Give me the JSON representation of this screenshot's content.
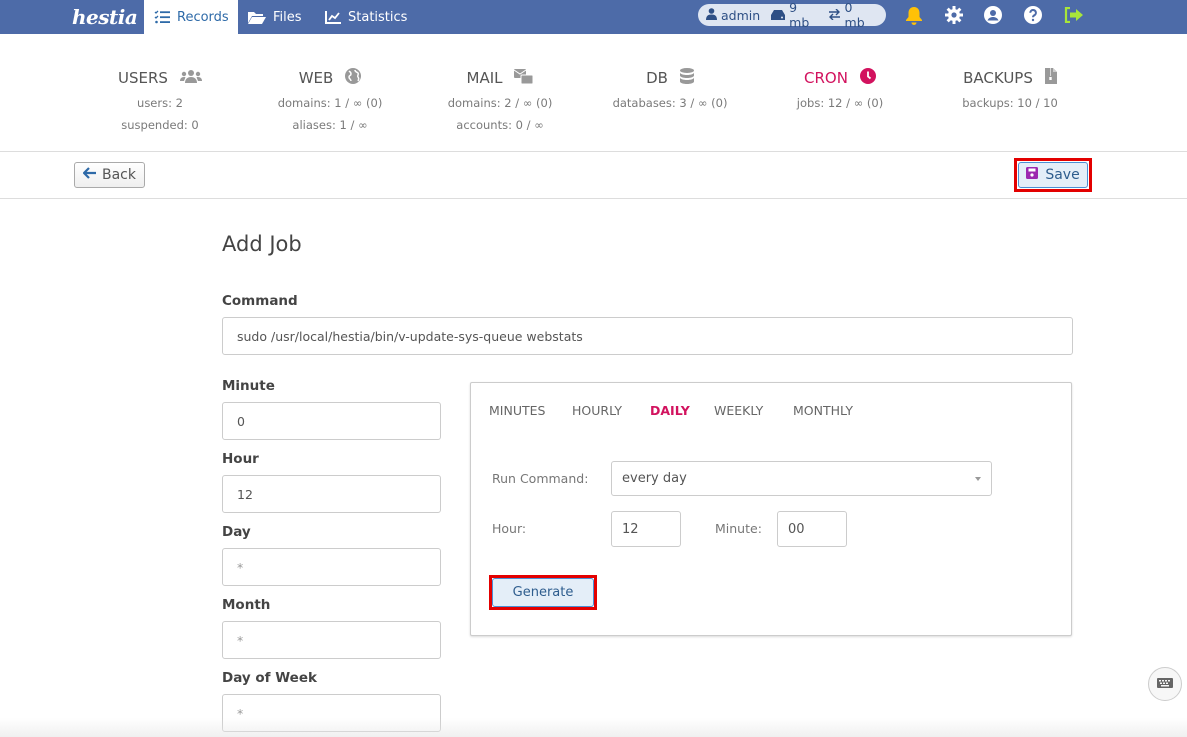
{
  "app": {
    "logo_text": "hestia"
  },
  "nav": {
    "tabs": [
      {
        "label": "Records",
        "icon": "records-list-icon",
        "active": true
      },
      {
        "label": "Files",
        "icon": "folder-open-icon",
        "active": false
      },
      {
        "label": "Statistics",
        "icon": "chart-line-icon",
        "active": false
      }
    ]
  },
  "user_status": {
    "username": "admin",
    "disk": "9 mb",
    "bandwidth": "0 mb"
  },
  "top_icons": [
    "bell-icon",
    "gear-icon",
    "user-circle-icon",
    "help-icon",
    "logout-icon"
  ],
  "colors": {
    "topbar": "#4d6ba8",
    "accent": "#d2125e",
    "bell": "#ffc107",
    "logout": "#a8e63a",
    "highlight": "#e30000"
  },
  "stats": [
    {
      "title": "USERS",
      "icon": "users-icon",
      "lines": [
        "users: 2",
        "suspended: 0"
      ],
      "active": false
    },
    {
      "title": "WEB",
      "icon": "globe-icon",
      "lines": [
        "domains: 1 / ∞ (0)",
        "aliases: 1 / ∞"
      ],
      "active": false
    },
    {
      "title": "MAIL",
      "icon": "mail-icon",
      "lines": [
        "domains: 2 / ∞ (0)",
        "accounts: 0 / ∞"
      ],
      "active": false
    },
    {
      "title": "DB",
      "icon": "database-icon",
      "lines": [
        "databases: 3 / ∞ (0)"
      ],
      "active": false
    },
    {
      "title": "CRON",
      "icon": "clock-icon",
      "lines": [
        "jobs: 12 / ∞ (0)"
      ],
      "active": true
    },
    {
      "title": "BACKUPS",
      "icon": "file-archive-icon",
      "lines": [
        "backups: 10 / 10"
      ],
      "active": false
    }
  ],
  "toolbar": {
    "back_label": "Back",
    "save_label": "Save"
  },
  "form": {
    "title": "Add Job",
    "command": {
      "label": "Command",
      "value": "sudo /usr/local/hestia/bin/v-update-sys-queue webstats"
    },
    "minute": {
      "label": "Minute",
      "value": "0"
    },
    "hour": {
      "label": "Hour",
      "value": "12"
    },
    "day": {
      "label": "Day",
      "value": "*"
    },
    "month": {
      "label": "Month",
      "value": "*"
    },
    "day_of_week": {
      "label": "Day of Week",
      "value": "*"
    }
  },
  "generator": {
    "tabs": [
      {
        "label": "MINUTES",
        "active": false
      },
      {
        "label": "HOURLY",
        "active": false
      },
      {
        "label": "DAILY",
        "active": true
      },
      {
        "label": "WEEKLY",
        "active": false
      },
      {
        "label": "MONTHLY",
        "active": false
      }
    ],
    "run_command_label": "Run Command:",
    "run_command_value": "every day",
    "hour_label": "Hour:",
    "hour_value": "12",
    "minute_label": "Minute:",
    "minute_value": "00",
    "generate_label": "Generate"
  }
}
